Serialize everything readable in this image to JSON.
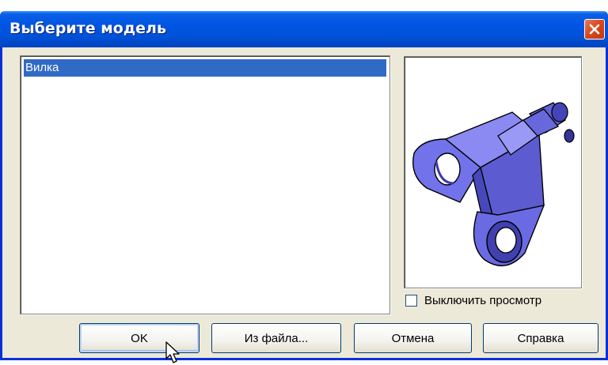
{
  "window": {
    "title": "Выберите модель",
    "close_icon": "close-icon"
  },
  "model_list": {
    "items": [
      {
        "label": "Вилка",
        "selected": true
      }
    ]
  },
  "preview": {
    "image_icon": "fork-part-3d-model",
    "toggle_label": "Выключить просмотр",
    "toggle_checked": false
  },
  "buttons": {
    "ok": "OK",
    "from_file": "Из файла...",
    "cancel": "Отмена",
    "help": "Справка"
  },
  "colors": {
    "titlebar": "#0054e3",
    "selection": "#316ac5",
    "dialog_bg": "#ece9d8",
    "close_button": "#d6471b",
    "model_fill": "#6e6ee8"
  }
}
